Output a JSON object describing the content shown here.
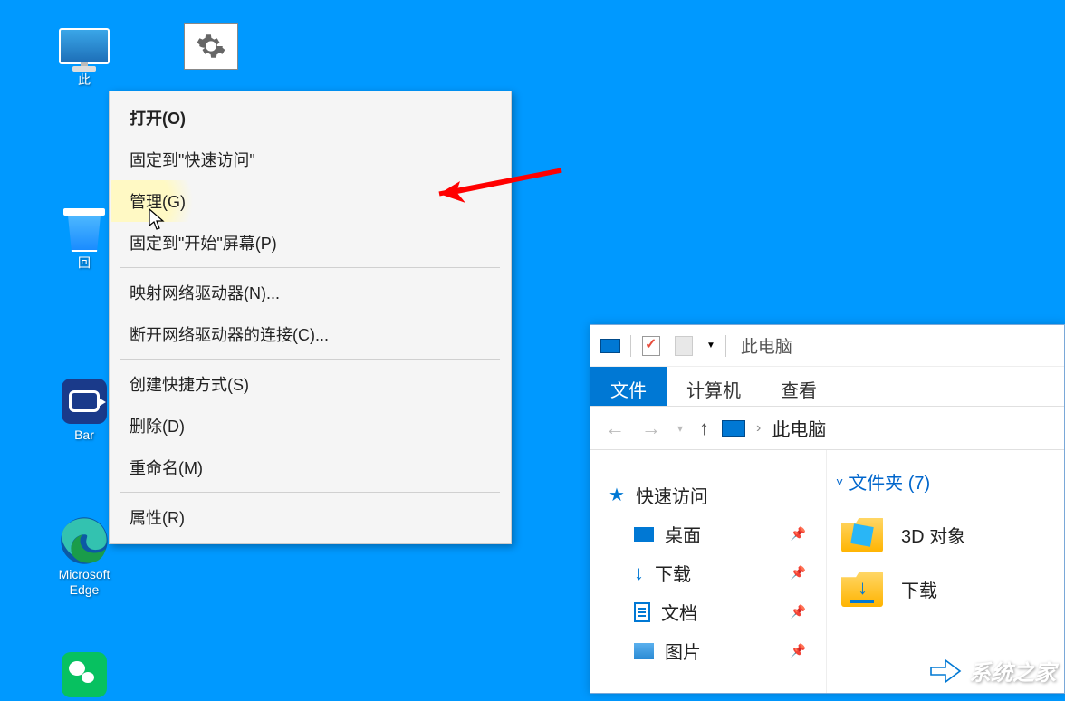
{
  "desktop": {
    "this_pc_label": "此",
    "recycle_label": "回",
    "bandicam_label": "Bar",
    "edge_label": "Microsoft\nEdge"
  },
  "context_menu": {
    "open": "打开(O)",
    "pin_quick": "固定到\"快速访问\"",
    "manage": "管理(G)",
    "pin_start": "固定到\"开始\"屏幕(P)",
    "map_drive": "映射网络驱动器(N)...",
    "disconnect_drive": "断开网络驱动器的连接(C)...",
    "create_shortcut": "创建快捷方式(S)",
    "delete": "删除(D)",
    "rename": "重命名(M)",
    "properties": "属性(R)"
  },
  "explorer": {
    "title": "此电脑",
    "tabs": {
      "file": "文件",
      "computer": "计算机",
      "view": "查看"
    },
    "addr": {
      "location": "此电脑",
      "sep": "›"
    },
    "nav": {
      "quick_access": "快速访问",
      "desktop": "桌面",
      "downloads": "下载",
      "documents": "文档",
      "pictures": "图片"
    },
    "section": {
      "folders": "文件夹 (7)"
    },
    "items": {
      "objects3d": "3D 对象",
      "downloads": "下载"
    }
  },
  "watermark": "系统之家"
}
